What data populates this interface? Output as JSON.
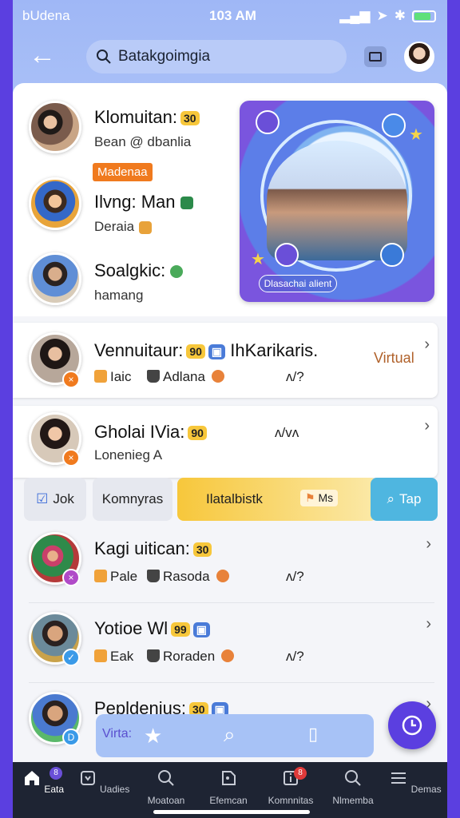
{
  "status_bar": {
    "carrier": "bUdena",
    "time": "103 AM"
  },
  "search": {
    "value": "Batakgoimgia"
  },
  "colors": {
    "accent": "#5b3fe0",
    "header": "#a9c0f7",
    "orange": "#f07a1e",
    "yellow": "#f7c73b",
    "teal": "#4fb6e0"
  },
  "featured": {
    "items": [
      {
        "name": "Klomuitan:",
        "badge": "30",
        "subtitle": "Bean @ dbanlia",
        "avatar_icon": "family-avatar-icon"
      },
      {
        "name": "Ilvng: Man",
        "subtitle": "Deraia",
        "avatar_icon": "kids-avatar-icon"
      },
      {
        "name": "Soalgkic:",
        "subtitle": "hamang",
        "avatar_icon": "man-avatar-icon"
      }
    ],
    "tag": "Madenaa",
    "hero_caption": "Dlasachai alient"
  },
  "list": [
    {
      "name": "Vennuitaur:",
      "badge": "90",
      "suffix": "IhKarikaris.",
      "meta1": "Iaic",
      "meta2": "Adlana",
      "count": "ʌ/?",
      "label": "Virtual"
    },
    {
      "name": "Gholai IVia:",
      "badge": "90",
      "sub": "Lonenieg A",
      "count": "ʌ/vʌ"
    },
    {
      "name": "Kagi uitican:",
      "badge": "30",
      "meta1": "Pale",
      "meta2": "Rasoda",
      "count": "ʌ/?"
    },
    {
      "name": "Yotioe Wl",
      "badge": "99",
      "meta1": "Eak",
      "meta2": "Roraden",
      "count": "ʌ/?"
    },
    {
      "name": "Pepldenius:",
      "badge": "30"
    }
  ],
  "tabs": [
    {
      "label": "Jok",
      "icon": "check-icon"
    },
    {
      "label": "Komnyras"
    },
    {
      "label": "Ilatalbistk",
      "chip": "Ms"
    },
    {
      "label": "Tap",
      "icon": "search-icon"
    }
  ],
  "floatbar": {
    "label": "Virta:"
  },
  "nav": [
    {
      "label": "Eata",
      "icon": "home-icon",
      "badge": "8"
    },
    {
      "label": "Uadies",
      "icon": "cart-icon"
    },
    {
      "label": "Moatoan",
      "icon": "search-icon"
    },
    {
      "label": "Efemcan",
      "icon": "tag-icon"
    },
    {
      "label": "Komnnitas",
      "icon": "info-icon",
      "badge": "8"
    },
    {
      "label": "Nlmemba",
      "icon": "search-icon"
    },
    {
      "label": "Demas",
      "icon": "menu-icon"
    }
  ]
}
